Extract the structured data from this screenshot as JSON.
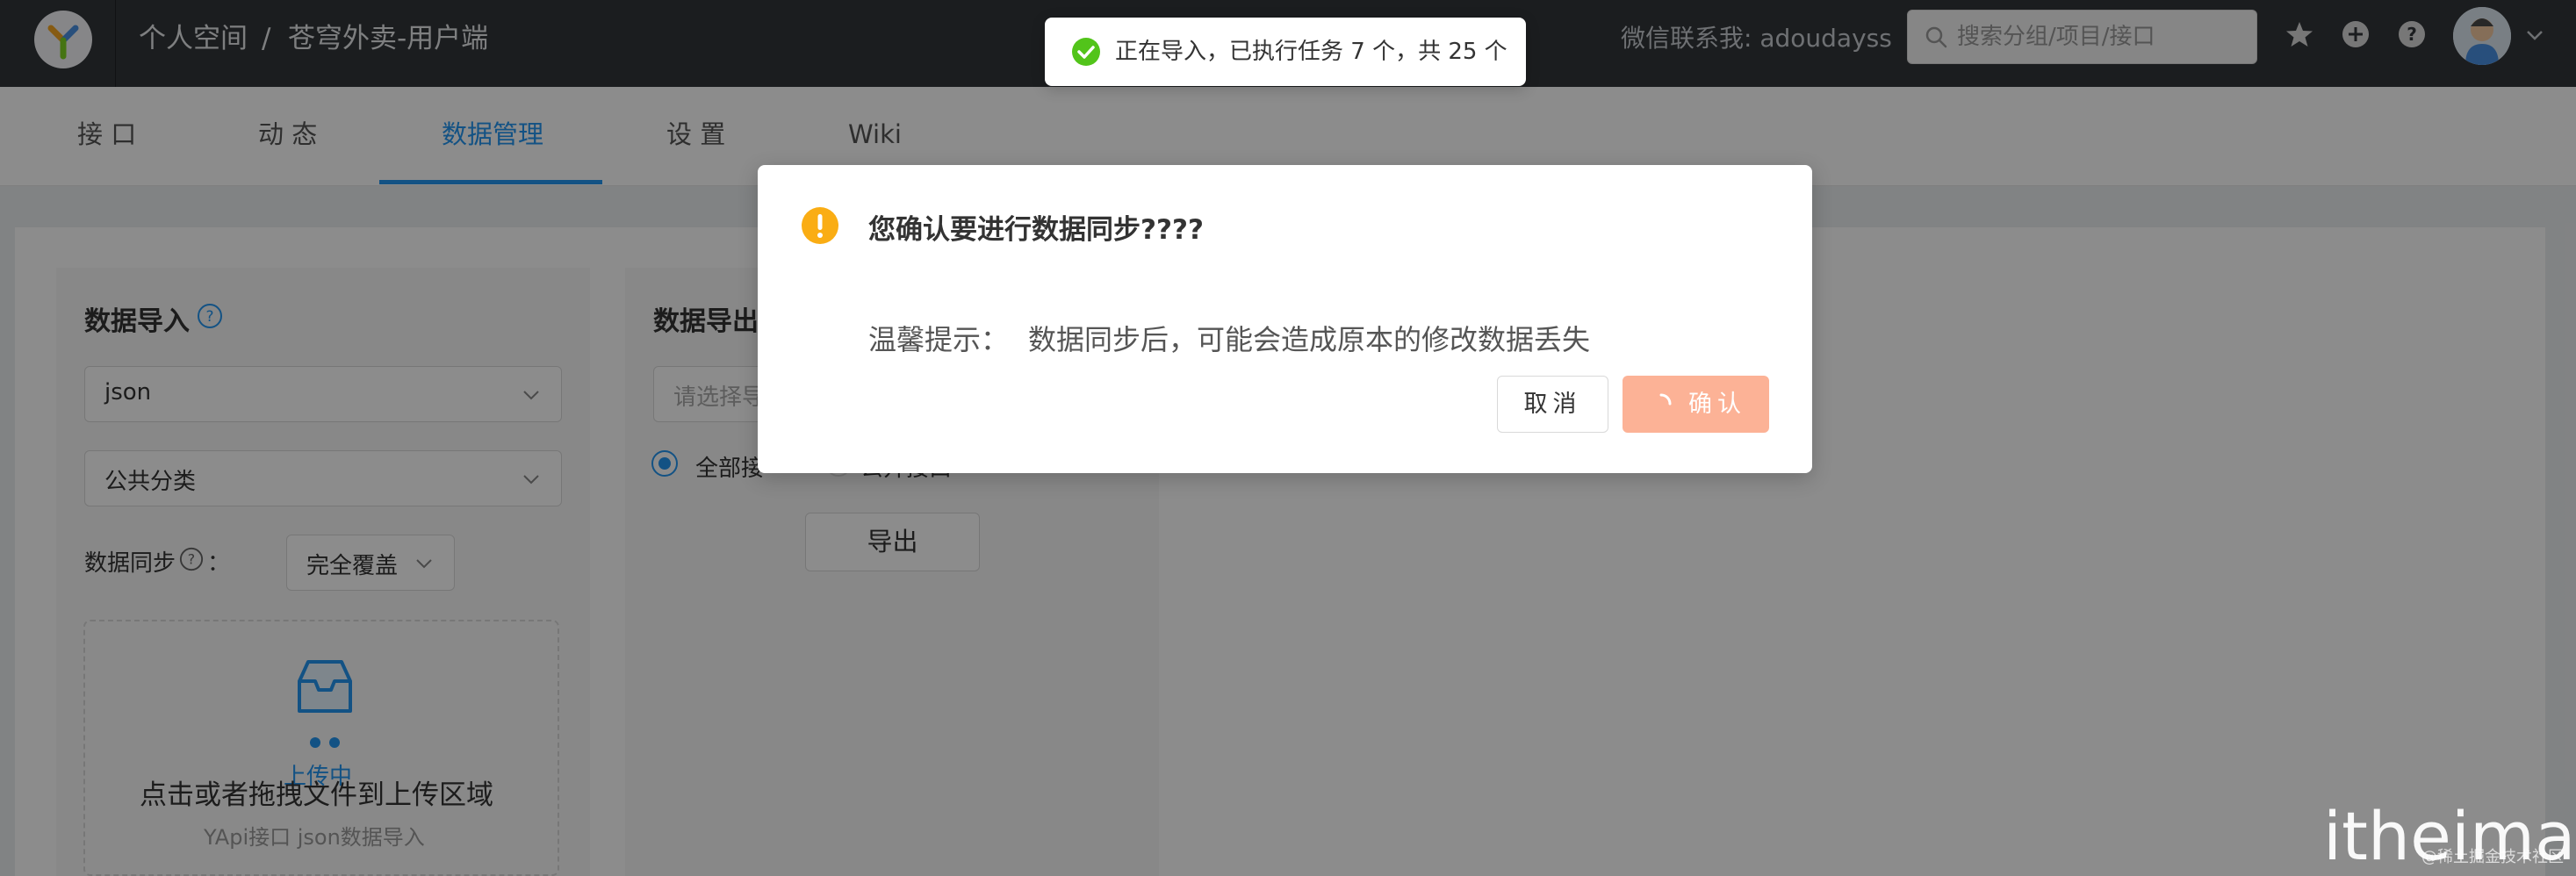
{
  "header": {
    "breadcrumb": [
      "个人空间",
      "苍穹外卖-用户端"
    ],
    "breadcrumb_separator": "/",
    "wechat": "微信联系我: adoudayss",
    "search_placeholder": "搜索分组/项目/接口",
    "icons": [
      "logo-icon",
      "star-icon",
      "plus-circle-icon",
      "question-circle-icon",
      "avatar",
      "chevron-down-icon"
    ]
  },
  "subnav": {
    "tabs": [
      "接 口",
      "动 态",
      "数据管理",
      "设 置",
      "Wiki"
    ],
    "active_index": 2,
    "active_color": "#2395f1"
  },
  "import_panel": {
    "title": "数据导入",
    "format_value": "json",
    "category_value": "公共分类",
    "sync_label": "数据同步",
    "sync_colon": "：",
    "sync_value": "完全覆盖",
    "upload_status": "上传中",
    "upload_text": "点击或者拖拽文件到上传区域",
    "upload_hint": "YApi接口 json数据导入"
  },
  "export_panel": {
    "title": "数据导出",
    "select_placeholder": "请选择导",
    "radio_all": "全部接",
    "radio_public": "公开接口",
    "export_button": "导出"
  },
  "modal": {
    "title": "您确认要进行数据同步????",
    "tip_label": "温馨提示：",
    "tip_text": "数据同步后，可能会造成原本的修改数据丢失",
    "cancel_label": "取消",
    "ok_label": "确认",
    "ok_color": "#fcb296",
    "warn_color": "#faad14"
  },
  "toast": {
    "text": "正在导入，已执行任务 7 个，共 25 个",
    "success_color": "#52c41a"
  },
  "watermark": {
    "text": "itheima",
    "subtext": "@稀土掘金技术社区"
  }
}
